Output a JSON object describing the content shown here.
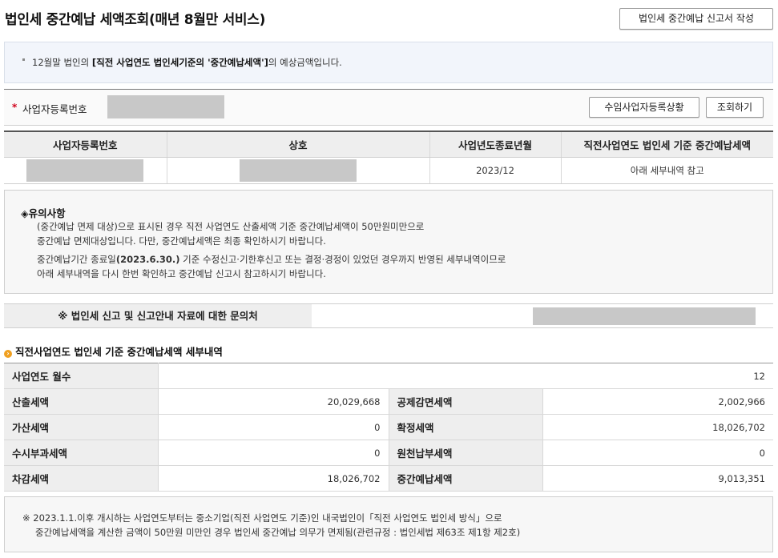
{
  "header": {
    "title": "법인세 중간예납 세액조회(매년 8월만 서비스)",
    "report_button": "법인세 중간예납 신고서 작성"
  },
  "notice": {
    "prefix": "12월말 법인의 ",
    "emphasis": "[직전 사업연도 법인세기준의 '중간예납세액']",
    "suffix": "의 예상금액입니다."
  },
  "search": {
    "required_mark": "*",
    "label": "사업자등록번호",
    "status_button": "수임사업자등록상황",
    "search_button": "조회하기"
  },
  "result_table": {
    "headers": [
      "사업자등록번호",
      "상호",
      "사업년도종료년월",
      "직전사업연도 법인세 기준 중간예납세액"
    ],
    "row": {
      "period_end": "2023/12",
      "amount": "아래 세부내역 참고"
    }
  },
  "caution": {
    "title": "◈유의사항",
    "lines": [
      "(중간예납 면제 대상)으로 표시된 경우 직전 사업연도 산출세액 기준 중간예납세액이 50만원미만으로",
      "중간예납 면제대상입니다. 다만, 중간예납세액은 최종 확인하시기 바랍니다.",
      "아래 세부내역을 다시 한번 확인하고 중간예납 신고시 참고하시기 바랍니다."
    ],
    "line3_prefix": "중간예납기간 종료일",
    "line3_bold": "(2023.6.30.)",
    "line3_suffix": " 기준 수정신고·기한후신고 또는 결정·경정이 있었던 경우까지 반영된 세부내역이므로"
  },
  "contact": {
    "label": "※ 법인세 신고 및 신고안내 자료에 대한 문의처"
  },
  "detail": {
    "section_title": "직전사업연도 법인세 기준 중간예납세액 세부내역",
    "months_label": "사업연도 월수",
    "months_value": "12",
    "rows": [
      {
        "left_label": "산출세액",
        "left_value": "20,029,668",
        "right_label": "공제감면세액",
        "right_value": "2,002,966"
      },
      {
        "left_label": "가산세액",
        "left_value": "0",
        "right_label": "확정세액",
        "right_value": "18,026,702"
      },
      {
        "left_label": "수시부과세액",
        "left_value": "0",
        "right_label": "원천납부세액",
        "right_value": "0"
      },
      {
        "left_label": "차감세액",
        "left_value": "18,026,702",
        "right_label": "중간예납세액",
        "right_value": "9,013,351"
      }
    ]
  },
  "footnote": {
    "line1": "※ 2023.1.1.이후 개시하는 사업연도부터는 중소기업(직전 사업연도 기준)인 내국법인이「직전 사업연도 법인세 방식」으로",
    "line2": "중간예납세액을 계산한 금액이 50만원 미만인 경우 법인세 중간예납 의무가 면제됨(관련규정 : 법인세법 제63조 제1항 제2호)"
  }
}
